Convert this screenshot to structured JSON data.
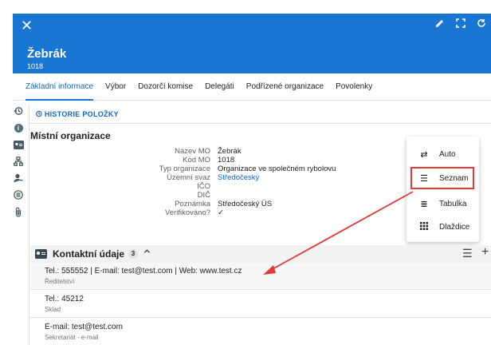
{
  "header": {
    "close_icon": "close-icon",
    "title": "Žebrák",
    "subtitle": "1018",
    "tools": [
      "edit-icon",
      "fullscreen-icon",
      "refresh-icon"
    ]
  },
  "tabs": [
    {
      "label": "Základní informace",
      "active": true
    },
    {
      "label": "Výbor"
    },
    {
      "label": "Dozorčí komise"
    },
    {
      "label": "Delegáti"
    },
    {
      "label": "Podřízené organizace"
    },
    {
      "label": "Povolenky"
    }
  ],
  "sidebar_icons": [
    "history-icon",
    "info-icon",
    "contact-card-icon",
    "hierarchy-icon",
    "user-key-icon",
    "list-icon",
    "attachment-icon"
  ],
  "history_button": "HISTORIE POLOŽKY",
  "section_title": "Místní organizace",
  "fields": [
    {
      "label": "Název MO",
      "value": "Žebrák"
    },
    {
      "label": "Kód MO",
      "value": "1018"
    },
    {
      "label": "Typ organizace",
      "value": "Organizace ve společném rybolovu"
    },
    {
      "label": "Územní svaz",
      "value": "Středočeský"
    },
    {
      "label": "IČO",
      "value": ""
    },
    {
      "label": "DIČ",
      "value": ""
    },
    {
      "label": "Poznámka",
      "value": "Středočeský ÚS"
    },
    {
      "label": "Verifikováno?",
      "value": "✓"
    }
  ],
  "view_menu": {
    "items": [
      {
        "label": "Auto",
        "icon": "swap-icon"
      },
      {
        "label": "Seznam",
        "icon": "list-view-icon",
        "highlighted": true
      },
      {
        "label": "Tabulka",
        "icon": "table-view-icon"
      },
      {
        "label": "Dlaždice",
        "icon": "tiles-view-icon"
      }
    ],
    "highlight_color": "#e53935"
  },
  "contacts": {
    "title": "Kontaktní údaje",
    "count": "3",
    "items": [
      {
        "line1": "Tel.: 555552 | E-mail: test@test.com | Web: www.test.cz",
        "line2": "Ředitelství"
      },
      {
        "line1": "Tel.: 45212",
        "line2": "Sklad"
      },
      {
        "line1": "E-mail: test@test.com",
        "line2": "Sekretariát - e-mail"
      }
    ]
  },
  "colors": {
    "header_bg": "#1976d2",
    "accent": "#1565c0",
    "annotation": "#e53935"
  }
}
